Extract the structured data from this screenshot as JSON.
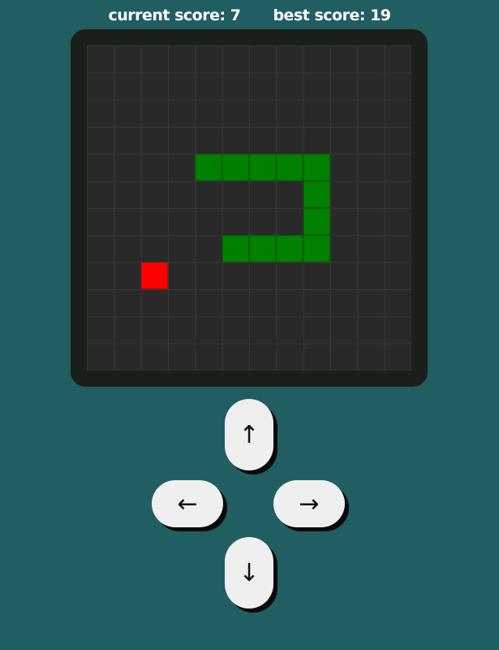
{
  "scores": {
    "current_label": "current score:",
    "current_value": "7",
    "best_label": "best score:",
    "best_value": "19"
  },
  "game": {
    "grid_cols": 12,
    "grid_rows": 12,
    "snake_cells": [
      [
        4,
        4
      ],
      [
        5,
        4
      ],
      [
        6,
        4
      ],
      [
        7,
        4
      ],
      [
        8,
        4
      ],
      [
        8,
        5
      ],
      [
        8,
        6
      ],
      [
        8,
        7
      ],
      [
        7,
        7
      ],
      [
        6,
        7
      ],
      [
        5,
        7
      ]
    ],
    "food_cell": [
      2,
      8
    ],
    "colors": {
      "board": "#292929",
      "grid_line": "#383838",
      "snake": "#008000",
      "snake_border": "#075a07",
      "food": "#ff0000",
      "frame": "#1b1f1a",
      "background": "#215e61"
    }
  },
  "controls": {
    "up": "↑",
    "down": "↓",
    "left": "←",
    "right": "→"
  }
}
